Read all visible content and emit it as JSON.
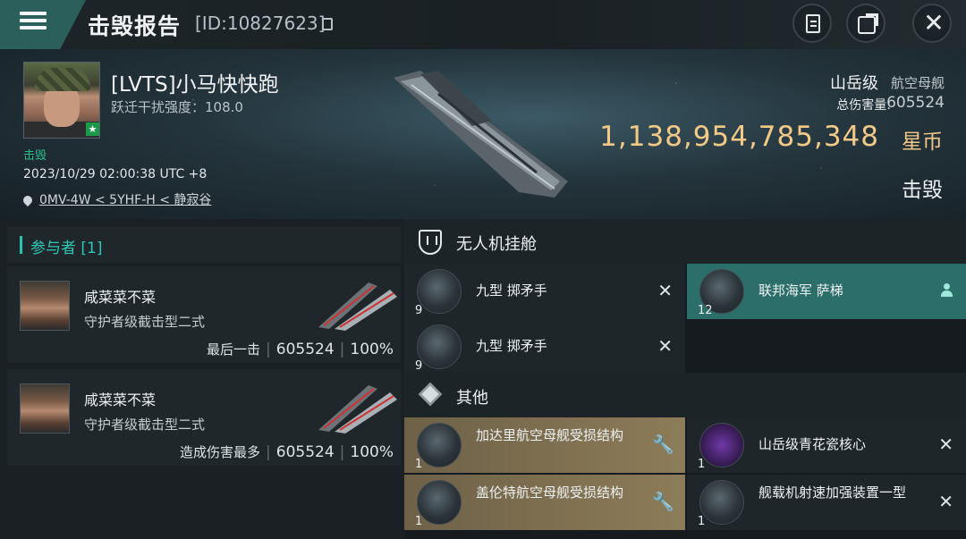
{
  "titlebar": {
    "title": "击毁报告",
    "id_text": "[ID:10827623]"
  },
  "victim": {
    "pilot_name": "[LVTS]小马快快跑",
    "warp_disruption": "跃迁干扰强度：108.0",
    "status_small": "击毁",
    "timestamp": "2023/10/29 02:00:38 UTC +8",
    "location": "0MV-4W < 5YHF-H < 静寂谷",
    "ship_class": "山岳级",
    "ship_type": "航空母舰",
    "damage_label": "总伤害量:",
    "damage_value": "605524",
    "isk_value": "1,138,954,785,348",
    "isk_unit": "星币",
    "status_big": "击毁"
  },
  "participants": {
    "header": "参与者 [1]",
    "rows": [
      {
        "name": "咸菜菜不菜",
        "ship": "守护者级截击型二式",
        "label": "最后一击",
        "damage": "605524",
        "percent": "100%"
      },
      {
        "name": "咸菜菜不菜",
        "ship": "守护者级截击型二式",
        "label": "造成伤害最多",
        "damage": "605524",
        "percent": "100%"
      }
    ]
  },
  "drops": {
    "drone_bay": {
      "title": "无人机挂舱",
      "items": [
        {
          "name": "九型 掷矛手",
          "qty": "9",
          "state": "destroyed"
        },
        {
          "name": "联邦海军 萨梯",
          "qty": "12",
          "state": "dropped"
        },
        {
          "name": "九型 掷矛手",
          "qty": "9",
          "state": "destroyed"
        }
      ]
    },
    "other": {
      "title": "其他",
      "items": [
        {
          "name": "加达里航空母舰受损结构",
          "qty": "1",
          "state": "fitted"
        },
        {
          "name": "山岳级青花瓷核心",
          "qty": "1",
          "state": "destroyed"
        },
        {
          "name": "盖伦特航空母舰受损结构",
          "qty": "1",
          "state": "fitted"
        },
        {
          "name": "舰载机射速加强装置一型",
          "qty": "1",
          "state": "destroyed"
        }
      ]
    }
  },
  "colors": {
    "accent_teal": "#2c6e69",
    "isk_gold": "#f3c987",
    "participant_header": "#2fc7b6"
  }
}
